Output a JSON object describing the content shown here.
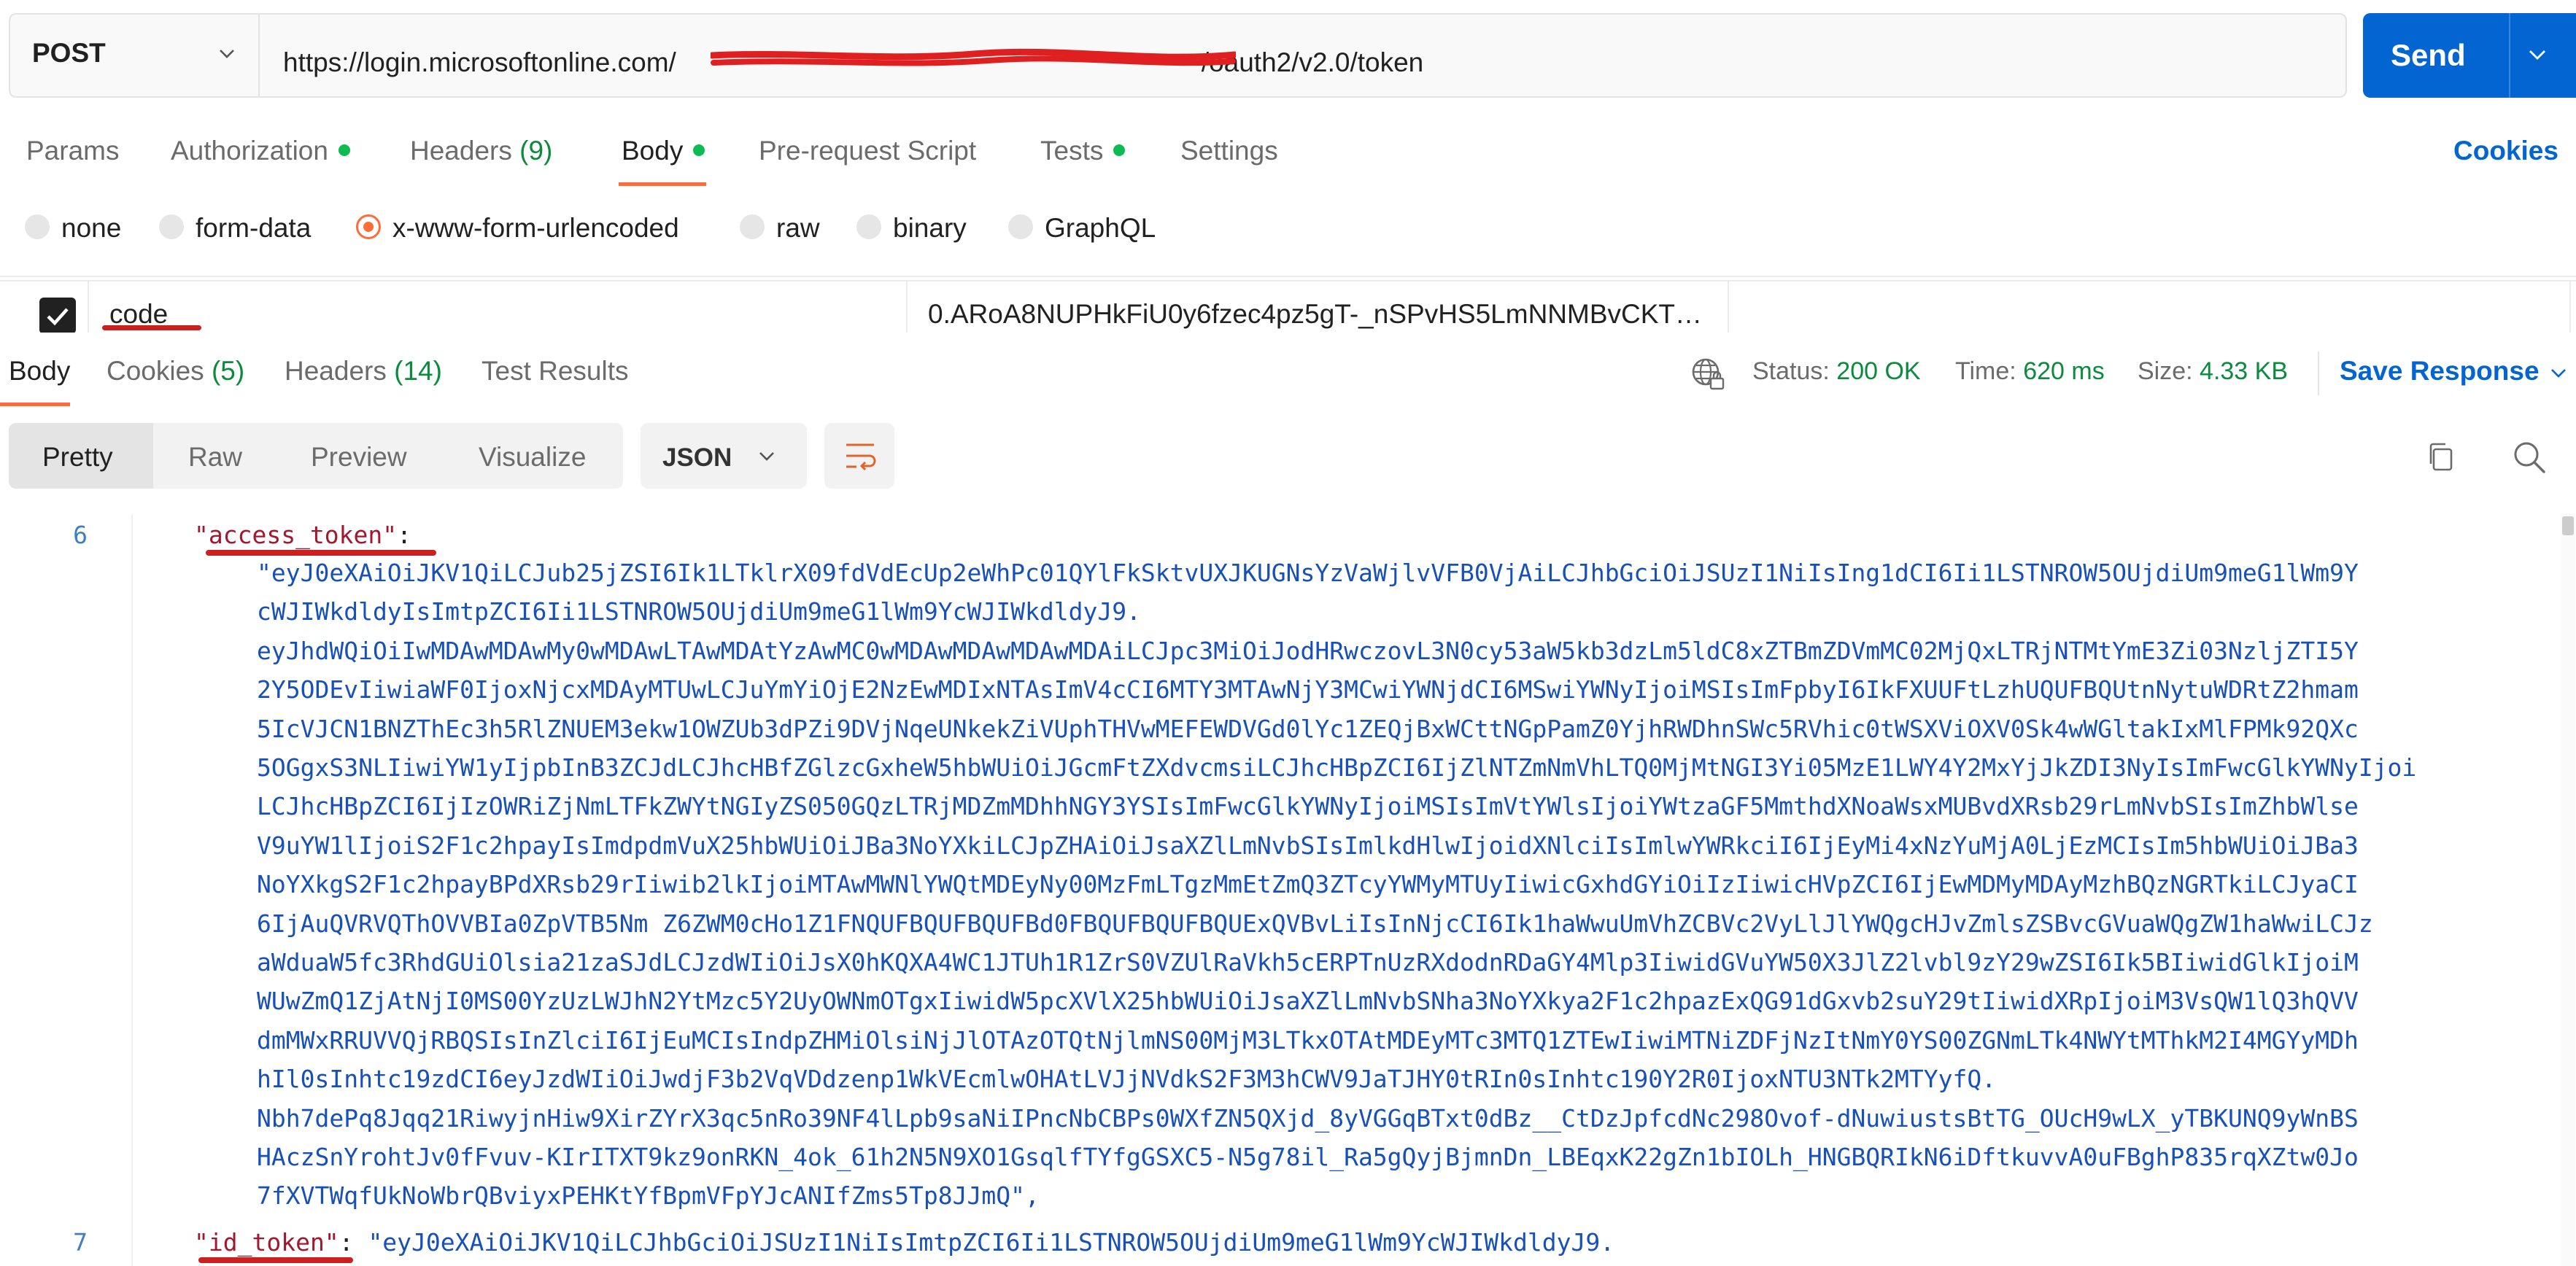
{
  "request": {
    "method": "POST",
    "url_prefix": "https://login.microsoftonline.com/",
    "url_redacted": "██████████████████████████",
    "url_suffix": "/oauth2/v2.0/token",
    "send_label": "Send"
  },
  "request_tabs": {
    "params": "Params",
    "authorization": "Authorization",
    "headers": "Headers",
    "headers_count": "(9)",
    "body": "Body",
    "prerequest": "Pre-request Script",
    "tests": "Tests",
    "settings": "Settings",
    "cookies": "Cookies"
  },
  "body_types": {
    "none": "none",
    "form_data": "form-data",
    "urlencoded": "x-www-form-urlencoded",
    "raw": "raw",
    "binary": "binary",
    "graphql": "GraphQL",
    "selected": "x-www-form-urlencoded"
  },
  "param_row": {
    "key": "code",
    "value": "0.ARoA8NUPHkFiU0y6fzec4pz5gT-_nSPvHS5LmNNMBvCKT…"
  },
  "response_tabs": {
    "body": "Body",
    "cookies": "Cookies",
    "cookies_count": "(5)",
    "headers": "Headers",
    "headers_count": "(14)",
    "test_results": "Test Results"
  },
  "response_status": {
    "status_label": "Status:",
    "status_value": "200 OK",
    "time_label": "Time:",
    "time_value": "620 ms",
    "size_label": "Size:",
    "size_value": "4.33 KB",
    "save_response": "Save Response"
  },
  "view_modes": {
    "pretty": "Pretty",
    "raw": "Raw",
    "preview": "Preview",
    "visualize": "Visualize",
    "format": "JSON"
  },
  "code": {
    "line6_num": "6",
    "line7_num": "7",
    "access_key": "\"access_token\"",
    "access_colon": ":",
    "id_key": "\"id_token\"",
    "id_colon": ": ",
    "id_value": "\"eyJ0eXAiOiJKV1QiLCJhbGciOiJSUzI1NiIsImtpZCI6Ii1LSTNROW5OUjdiUm9meG1lWm9YcWJIWkdldyJ9.",
    "access_lines": [
      "\"eyJ0eXAiOiJKV1QiLCJub25jZSI6Ik1LTklrX09fdVdEcUp2eWhPc01QYlFkSktvUXJKUGNsYzVaWjlvVFB0VjAiLCJhbGciOiJSUzI1NiIsIng1dCI6Ii1LSTNROW5OUjdiUm9meG1lWm9Y",
      "cWJIWkdldyIsImtpZCI6Ii1LSTNROW5OUjdiUm9meG1lWm9YcWJIWkdldyJ9.",
      "eyJhdWQiOiIwMDAwMDAwMy0wMDAwLTAwMDAtYzAwMC0wMDAwMDAwMDAwMDAiLCJpc3MiOiJodHRwczovL3N0cy53aW5kb3dzLm5ldC8xZTBmZDVmMC02MjQxLTRjNTMtYmE3Zi03NzljZTI5Y",
      "2Y5ODEvIiwiaWF0IjoxNjcxMDAyMTUwLCJuYmYiOjE2NzEwMDIxNTAsImV4cCI6MTY3MTAwNjY3MCwiYWNjdCI6MSwiYWNyIjoiMSIsImFpbyI6IkFXUUFtLzhUQUFBQUtnNytuWDRtZ2hmam",
      "5IcVJCN1BNZThEc3h5RlZNUEM3ekw1OWZUb3dPZi9DVjNqeUNkekZiVUphTHVwMEFEWDVGd0lYc1ZEQjBxWCttNGpPamZ0YjhRWDhnSWc5RVhic0tWSXViOXV0Sk4wWGltakIxMlFPMk92QXc",
      "5OGgxS3NLIiwiYW1yIjpbInB3ZCJdLCJhcHBfZGlzcGxheW5hbWUiOiJGcmFtZXdvcmsiLCJhcHBpZCI6IjZlNTZmNmVhLTQ0MjMtNGI3Yi05MzE1LWY4Y2MxYjJkZDI3NyIsImFwcGlkYWNyIjoi",
      "LCJhcHBpZCI6IjIzOWRiZjNmLTFkZWYtNGIyZS050GQzLTRjMDZmMDhhNGY3YSIsImFwcGlkYWNyIjoiMSIsImVtYWlsIjoiYWtzaGF5MmthdXNoaWsxMUBvdXRsb29rLmNvbSIsImZhbWlse",
      "V9uYW1lIjoiS2F1c2hpayIsImdpdmVuX25hbWUiOiJBa3NoYXkiLCJpZHAiOiJsaXZlLmNvbSIsImlkdHlwIjoidXNlciIsImlwYWRkciI6IjEyMi4xNzYuMjA0LjEzMCIsIm5hbWUiOiJBa3",
      "NoYXkgS2F1c2hpayBPdXRsb29rIiwib2lkIjoiMTAwMWNlYWQtMDEyNy00MzFmLTgzMmEtZmQ3ZTcyYWMyMTUyIiwicGxhdGYiOiIzIiwicHVpZCI6IjEwMDMyMDAyMzhBQzNGRTkiLCJyaCI",
      "6IjAuQVRVQThOVVBIa0ZpVTB5Nm Z6ZWM0cHo1Z1FNQUFBQUFBQUFBd0FBQUFBQUFBQUExQVBvLiIsInNjcCI6Ik1haWwuUmVhZCBVc2VyLlJlYWQgcHJvZmlsZSBvcGVuaWQgZW1haWwiLCJz",
      "aWduaW5fc3RhdGUiOlsia21zaSJdLCJzdWIiOiJsX0hKQXA4WC1JTUh1R1ZrS0VZUlRaVkh5cERPTnUzRXdodnRDaGY4Mlp3IiwidGVuYW50X3JlZ2lvbl9zY29wZSI6Ik5BIiwidGlkIjoiM",
      "WUwZmQ1ZjAtNjI0MS00YzUzLWJhN2YtMzc5Y2UyOWNmOTgxIiwidW5pcXVlX25hbWUiOiJsaXZlLmNvbSNha3NoYXkya2F1c2hpazExQG91dGxvb2suY29tIiwidXRpIjoiM3VsQW1lQ3hQVV",
      "dmMWxRRUVVQjRBQSIsInZlciI6IjEuMCIsIndpZHMiOlsiNjJlOTAzOTQtNjlmNS00MjM3LTkxOTAtMDEyMTc3MTQ1ZTEwIiwiMTNiZDFjNzItNmY0YS00ZGNmLTk4NWYtMThkM2I4MGYyMDh",
      "hIl0sInhtc19zdCI6eyJzdWIiOiJwdjF3b2VqVDdzenp1WkVEcmlwOHAtLVJjNVdkS2F3M3hCWV9JaTJHY0tRIn0sInhtc190Y2R0IjoxNTU3NTk2MTYyfQ.",
      "Nbh7dePq8Jqq21RiwyjnHiw9XirZYrX3qc5nRo39NF4lLpb9saNiIPncNbCBPs0WXfZN5QXjd_8yVGGqBTxt0dBz__CtDzJpfcdNc298Ovof-dNuwiustsBtTG_OUcH9wLX_yTBKUNQ9yWnBS",
      "HAczSnYrohtJv0fFvuv-KIrITXT9kz9onRKN_4ok_61h2N5N9XO1GsqlfTYfgGSXC5-N5g78il_Ra5gQyjBjmnDn_LBEqxK22gZn1bIOLh_HNGBQRIkN6iDftkuvvA0uFBghP835rqXZtw0Jo",
      "7fXVTWqfUkNoWbrQBviyxPEHKtYfBpmVFpYJcANIfZms5Tp8JJmQ\","
    ]
  }
}
